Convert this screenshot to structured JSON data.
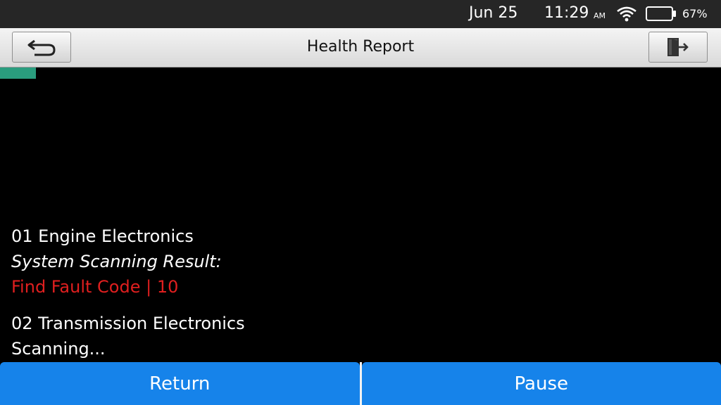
{
  "status_bar": {
    "date": "Jun 25",
    "time": "11:29",
    "ampm": "AM",
    "battery_percent": "67%",
    "icons": [
      "wifi-icon",
      "battery-icon"
    ]
  },
  "title_bar": {
    "title": "Health Report",
    "back_icon": "return-arrow-icon",
    "exit_icon": "exit-door-icon"
  },
  "progress": {
    "value": 0.05,
    "color": "#2a9d7e"
  },
  "scan": {
    "systems": [
      {
        "name": "01 Engine Electronics",
        "result_label": "System Scanning Result:",
        "result": "Find Fault Code | 10"
      },
      {
        "name": "02 Transmission Electronics",
        "status": "Scanning..."
      }
    ]
  },
  "buttons": {
    "return": "Return",
    "pause": "Pause"
  },
  "colors": {
    "accent": "#1683ea",
    "fault": "#e01f1f",
    "background": "#000000"
  }
}
